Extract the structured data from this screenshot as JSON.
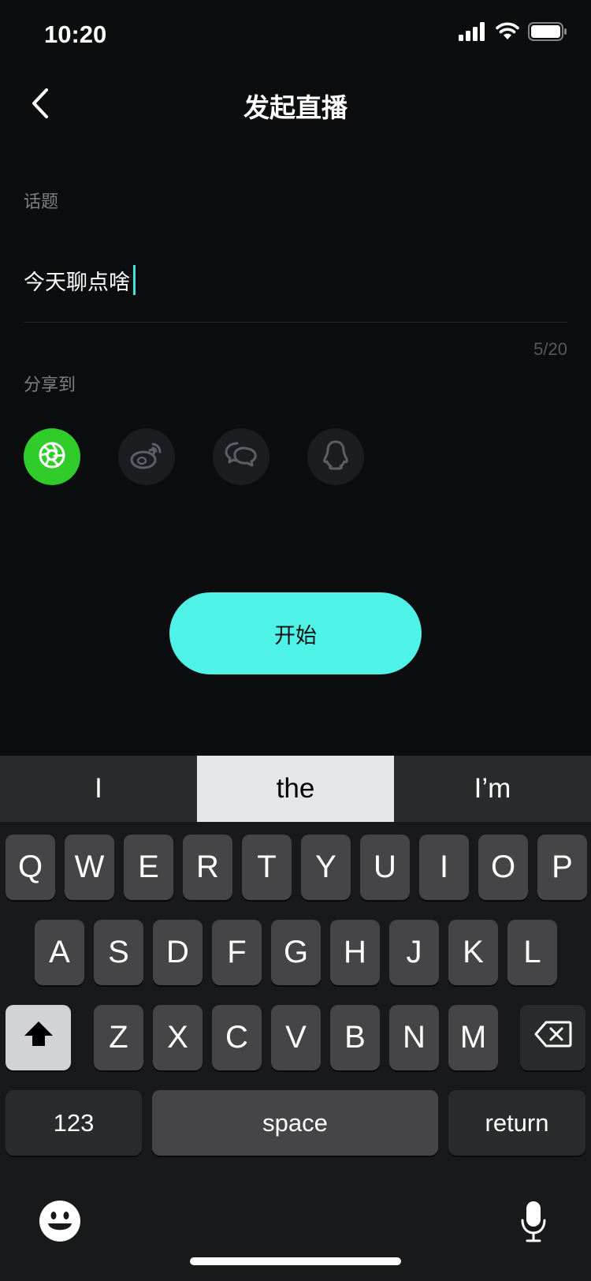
{
  "status_bar": {
    "time": "10:20",
    "icons": [
      "signal-icon",
      "wifi-icon",
      "battery-icon"
    ]
  },
  "header": {
    "title": "发起直播",
    "back_icon": "chevron-left-icon"
  },
  "topic": {
    "label": "话题",
    "value": "今天聊点啥",
    "counter": "5/20"
  },
  "share": {
    "label": "分享到",
    "targets": [
      {
        "name": "moments",
        "icon": "moments-icon",
        "selected": true,
        "color": "#2fcc2a"
      },
      {
        "name": "weibo",
        "icon": "weibo-icon",
        "selected": false
      },
      {
        "name": "wechat",
        "icon": "wechat-icon",
        "selected": false
      },
      {
        "name": "qq",
        "icon": "qq-icon",
        "selected": false
      }
    ]
  },
  "start_button": {
    "label": "开始",
    "color": "#4ef2e6"
  },
  "keyboard": {
    "suggestions": [
      "I",
      "the",
      "I’m"
    ],
    "row1": [
      "Q",
      "W",
      "E",
      "R",
      "T",
      "Y",
      "U",
      "I",
      "O",
      "P"
    ],
    "row2": [
      "A",
      "S",
      "D",
      "F",
      "G",
      "H",
      "J",
      "K",
      "L"
    ],
    "row3": [
      "Z",
      "X",
      "C",
      "V",
      "B",
      "N",
      "M"
    ],
    "numbers_key": "123",
    "space_key": "space",
    "return_key": "return"
  },
  "colors": {
    "accent": "#41e3dc",
    "background": "#0c0d0f"
  }
}
